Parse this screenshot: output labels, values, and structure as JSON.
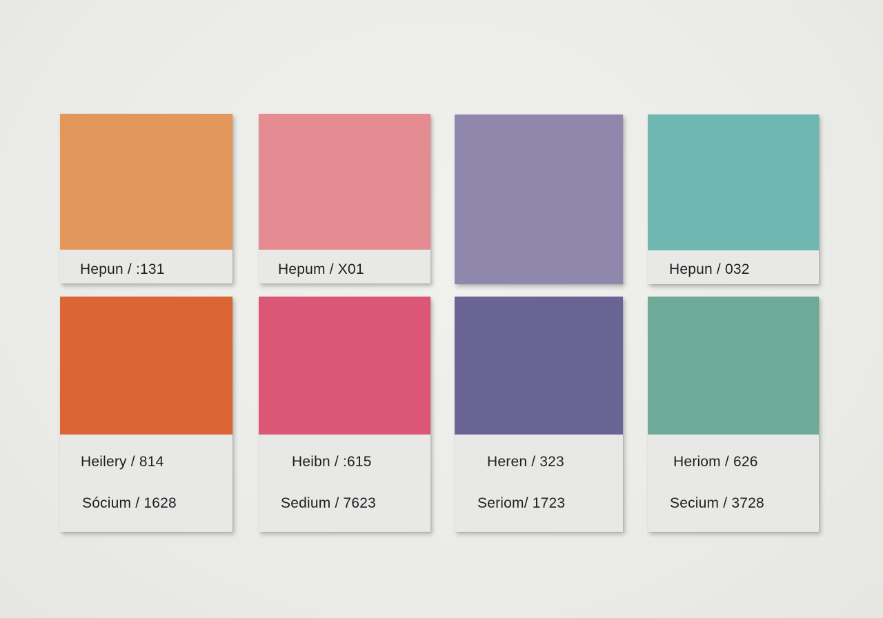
{
  "swatches_top": [
    {
      "color": "#e4975b",
      "label": "Hepun / :131"
    },
    {
      "color": "#e48c91",
      "label": "Hepum / X01"
    },
    {
      "color": "#8f88ac",
      "label": ""
    },
    {
      "color": "#6fb8b2",
      "label": "Hepun / 032"
    }
  ],
  "swatches_bottom": [
    {
      "color": "#dc6535",
      "line1": "Heilery / 814",
      "line2": "Sócium / 1628"
    },
    {
      "color": "#dc5775",
      "line1": "Heibn / :615",
      "line2": "Sedium / 7623"
    },
    {
      "color": "#6a6495",
      "line1": "Heren / 323",
      "line2": "Seriom/ 1723"
    },
    {
      "color": "#6eaa98",
      "line1": "Heriom / 626",
      "line2": "Secium / 3728"
    }
  ]
}
